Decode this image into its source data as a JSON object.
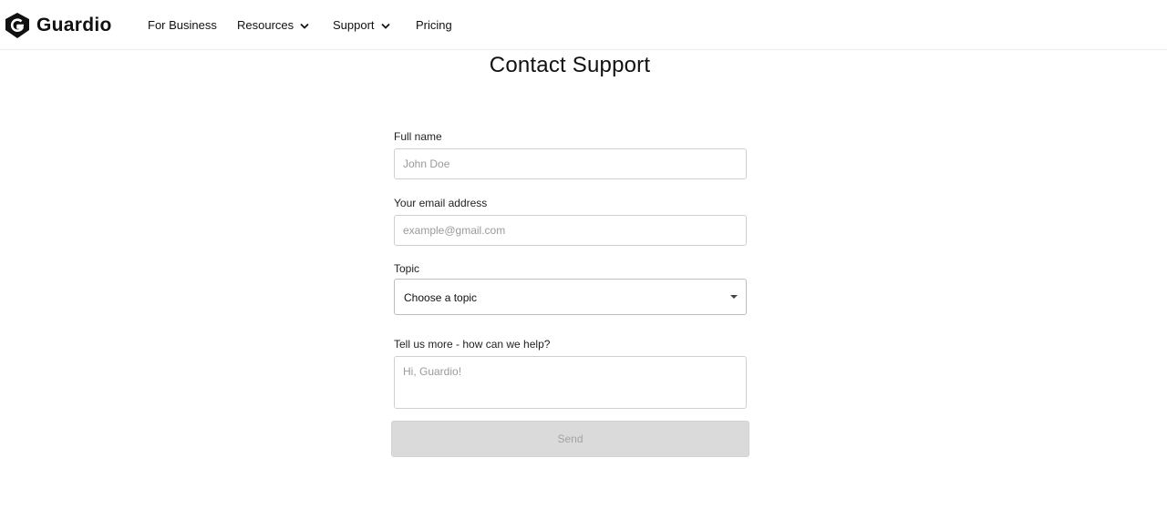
{
  "header": {
    "brand": "Guardio",
    "nav": [
      {
        "label": "For Business",
        "has_dropdown": false
      },
      {
        "label": "Resources",
        "has_dropdown": true
      },
      {
        "label": "Support",
        "has_dropdown": true
      },
      {
        "label": "Pricing",
        "has_dropdown": false
      }
    ],
    "icons": {
      "logo": "guardio-shield-logo-icon",
      "dropdown": "chevron-down-icon"
    }
  },
  "page": {
    "title": "Contact Support"
  },
  "form": {
    "full_name": {
      "label": "Full name",
      "placeholder": "John Doe",
      "value": ""
    },
    "email": {
      "label": "Your email address",
      "placeholder": "example@gmail.com",
      "value": ""
    },
    "topic": {
      "label": "Topic",
      "selected": "Choose a topic"
    },
    "message": {
      "label": "Tell us more - how can we help?",
      "placeholder": "Hi, Guardio!",
      "value": ""
    },
    "send_label": "Send"
  },
  "colors": {
    "background": "#ffffff",
    "text": "#111111",
    "button_disabled_bg": "#dadada",
    "button_disabled_text": "#a2a2a2",
    "input_border": "#cfcfcf"
  }
}
